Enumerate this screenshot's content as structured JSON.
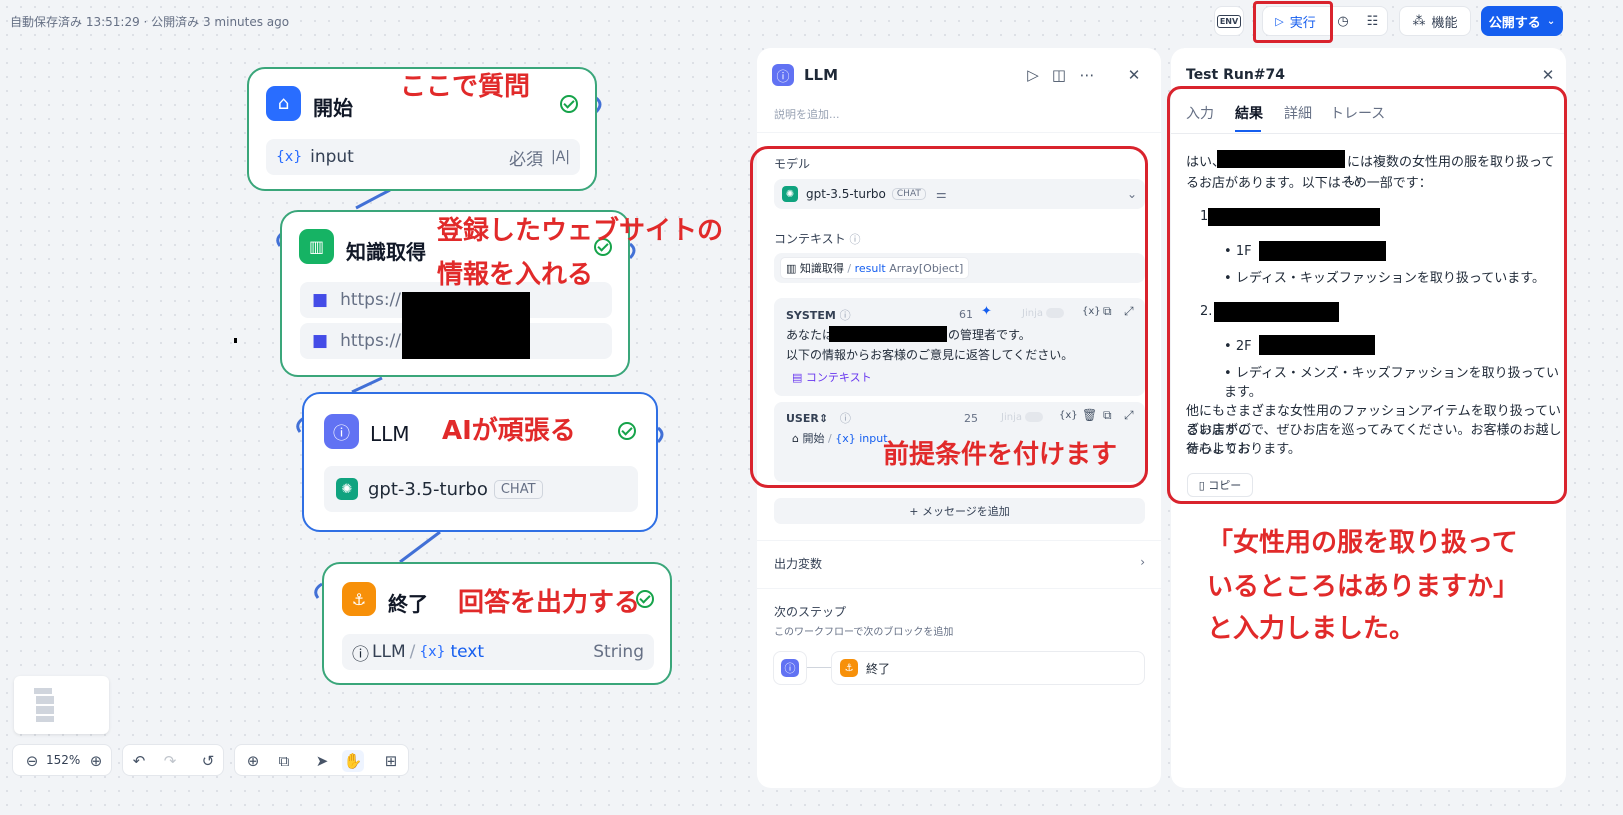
{
  "header": {
    "autosave": "自動保存済み 13:51:29 · 公開済み 3 minutes ago",
    "env": "ENV",
    "run": "実行",
    "features": "機能",
    "publish": "公開する"
  },
  "nodes": {
    "start": {
      "title": "開始",
      "var": "input",
      "required": "必須"
    },
    "knowledge": {
      "title": "知識取得",
      "url1": "https://",
      "url2": "https://"
    },
    "llm": {
      "title": "LLM",
      "model": "gpt-3.5-turbo",
      "badge": "CHAT"
    },
    "end": {
      "title": "終了",
      "src": "LLM",
      "var": "text",
      "type": "String"
    }
  },
  "annotations": {
    "start": "ここで質問",
    "knowledge_1": "登録したウェブサイトの",
    "knowledge_2": "情報を入れる",
    "llm": "AIが頑張る",
    "end": "回答を出力する",
    "prompt": "前提条件を付けます",
    "result_1": "「女性用の服を取り扱って",
    "result_2": "いるところはありますか」",
    "result_3": "と入力しました。"
  },
  "toolbar": {
    "zoom": "152%"
  },
  "llm_panel": {
    "title": "LLM",
    "desc_placeholder": "説明を追加...",
    "model_label": "モデル",
    "model": "gpt-3.5-turbo",
    "badge": "CHAT",
    "context_label": "コンテキスト",
    "context_node": "知識取得",
    "context_var": "result",
    "context_type": "Array[Object]",
    "system": {
      "label": "SYSTEM",
      "count": "61",
      "jinja": "Jinja",
      "line1a": "あなたは",
      "line1b": "の管理者です。",
      "line2": "以下の情報からお客様のご意見に返答してください。",
      "ctx": "コンテキスト"
    },
    "user": {
      "label": "USER",
      "count": "25",
      "jinja": "Jinja",
      "node": "開始",
      "var": "input"
    },
    "add_message": "メッセージを追加",
    "output_vars": "出力変数",
    "next_step": "次のステップ",
    "next_desc": "このワークフローで次のブロックを追加",
    "next_node": "終了"
  },
  "result_panel": {
    "title": "Test Run#74",
    "tabs": [
      "入力",
      "結果",
      "詳細",
      "トレース"
    ],
    "intro_a": "はい、",
    "intro_b": "には複数の女性用の服を取り扱ってい",
    "intro_c": "るお店があります。以下はその一部です：",
    "item1_num": "1.",
    "item1_floor": "1F",
    "item1_desc": "レディス・キッズファッションを取り扱っています。",
    "item2_num": "2.",
    "item2_floor": "2F",
    "item2_desc": "レディス・メンズ・キッズファッションを取り扱っています。",
    "outro_1": "他にもさまざまな女性用のファッションアイテムを取り扱っているお店がご",
    "outro_2": "ざいますので、ぜひお店を巡ってみてください。お客様のお越しを心よりお",
    "outro_3": "待ちしております。",
    "copy": "コピー"
  },
  "colors": {
    "primary": "#155eef",
    "node_border": "#3aa67a",
    "annotation": "#e12a2a",
    "llm_icon": "#6172f3"
  }
}
